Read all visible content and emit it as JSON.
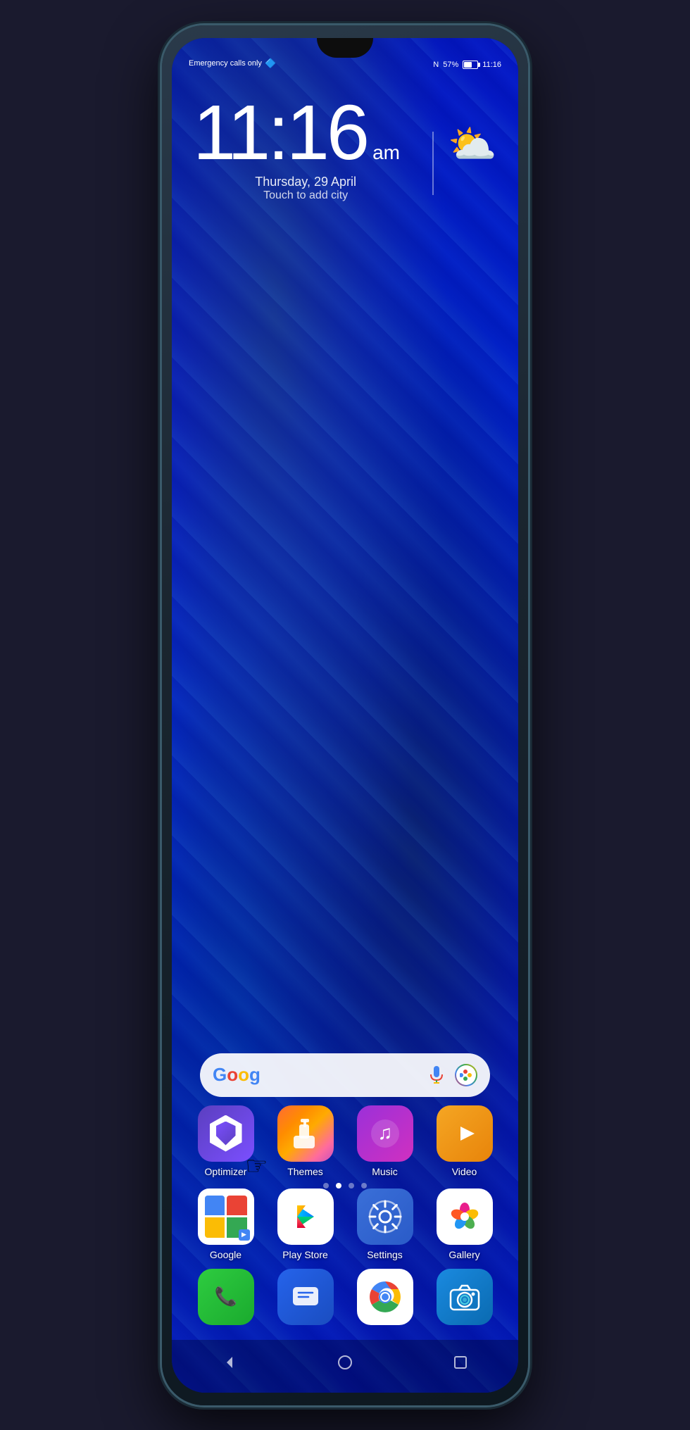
{
  "phone": {
    "status_bar": {
      "left": "Emergency calls only",
      "nfc": "N",
      "battery": "57%",
      "time": "11:16"
    },
    "clock": {
      "time": "11:16",
      "am_pm": "am",
      "date": "Thursday, 29 April",
      "subtitle": "Touch to add city"
    },
    "weather": {
      "icon": "⛅"
    },
    "search": {
      "placeholder": ""
    },
    "apps_row1": [
      {
        "id": "optimizer",
        "label": "Optimizer",
        "icon_type": "optimizer"
      },
      {
        "id": "themes",
        "label": "Themes",
        "icon_type": "themes"
      },
      {
        "id": "music",
        "label": "Music",
        "icon_type": "music"
      },
      {
        "id": "video",
        "label": "Video",
        "icon_type": "video"
      }
    ],
    "apps_row2": [
      {
        "id": "google",
        "label": "Google",
        "icon_type": "google"
      },
      {
        "id": "playstore",
        "label": "Play Store",
        "icon_type": "playstore"
      },
      {
        "id": "settings",
        "label": "Settings",
        "icon_type": "settings"
      },
      {
        "id": "gallery",
        "label": "Gallery",
        "icon_type": "gallery"
      }
    ],
    "dock": [
      {
        "id": "phone",
        "label": "",
        "icon_type": "phone"
      },
      {
        "id": "messages",
        "label": "",
        "icon_type": "messages"
      },
      {
        "id": "chrome",
        "label": "",
        "icon_type": "chrome"
      },
      {
        "id": "camera",
        "label": "",
        "icon_type": "camera"
      }
    ],
    "page_dots": [
      {
        "active": false
      },
      {
        "active": true
      },
      {
        "active": false
      },
      {
        "active": false
      }
    ],
    "nav": {
      "back": "◁",
      "home": "○",
      "recent": "□"
    }
  }
}
